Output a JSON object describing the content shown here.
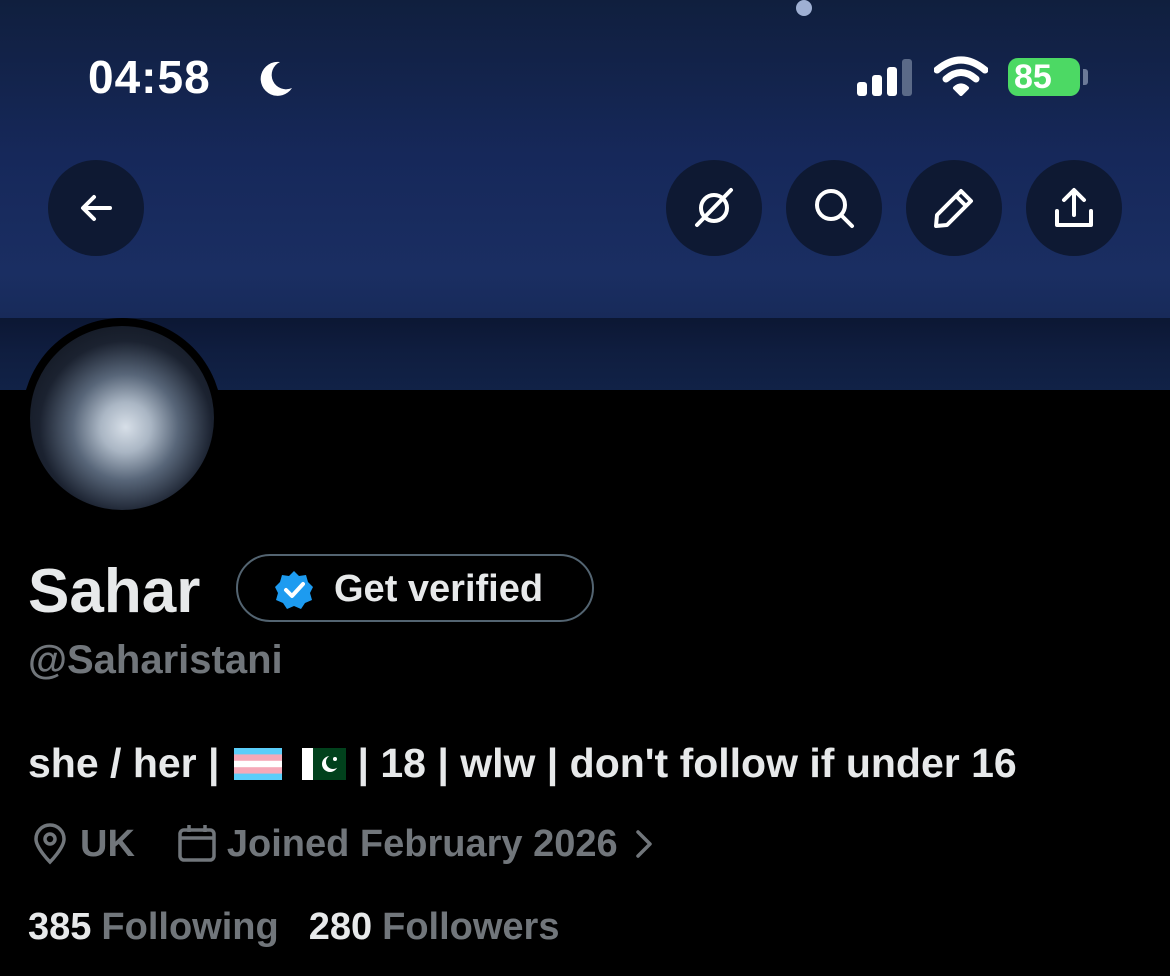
{
  "status_bar": {
    "time": "04:58",
    "battery": "85"
  },
  "profile": {
    "name": "Sahar",
    "handle": "@Saharistani",
    "verify_label": "Get verified",
    "bio": {
      "pronouns": "she / her |",
      "rest": "| 18 | wlw | don't follow if under 16"
    },
    "location": "UK",
    "joined": "Joined February 2026",
    "following_count": "385",
    "following_label": "Following",
    "followers_count": "280",
    "followers_label": "Followers"
  },
  "colors": {
    "accent": "#1d9bf0",
    "battery": "#4cd964",
    "muted": "#71767b",
    "text": "#e7e9ea"
  }
}
